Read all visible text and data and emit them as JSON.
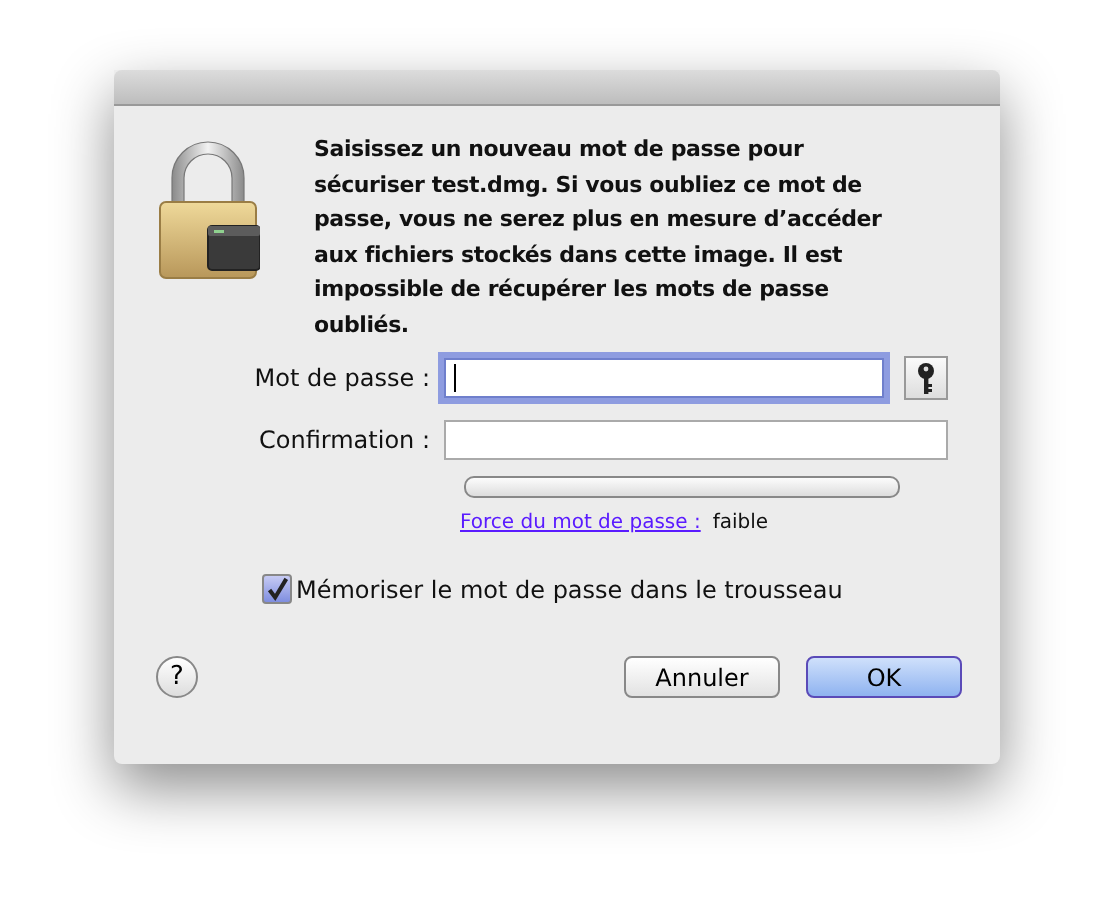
{
  "message": "Saisissez un nouveau mot de passe pour sécuriser test.dmg. Si vous oubliez ce mot de passe, vous ne serez plus en mesure d’accéder aux fichiers stockés dans cette image. Il est impossible de récupérer les mots de passe oubliés.",
  "fields": [
    {
      "label": "Mot de passe :",
      "focused": true,
      "kind": "password"
    },
    {
      "label": "Confirmation :",
      "focused": false,
      "kind": "confirm"
    }
  ],
  "strength": {
    "level": 0,
    "link": "Force du mot de passe :",
    "value": "faible"
  },
  "keychain": {
    "label": "Mémoriser le mot de passe dans le trousseau",
    "checked": true
  },
  "help": "?",
  "buttons": [
    {
      "label": "Annuler",
      "default": false
    },
    {
      "label": "OK",
      "default": true
    }
  ]
}
